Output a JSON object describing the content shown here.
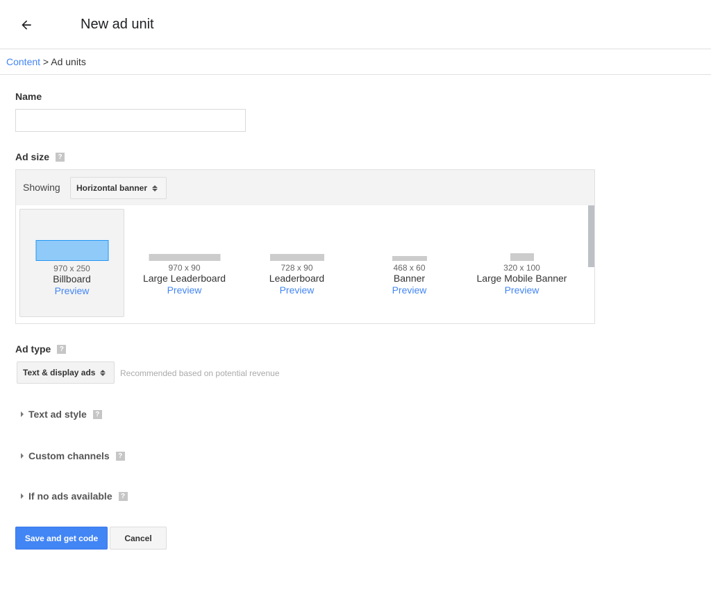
{
  "header": {
    "title": "New ad unit",
    "back_icon": "arrow-left-icon"
  },
  "breadcrumb": {
    "link": "Content",
    "separator": " > ",
    "current": "Ad units"
  },
  "form": {
    "name_label": "Name",
    "name_value": "",
    "ad_size_label": "Ad size",
    "help_glyph": "?",
    "showing_label": "Showing",
    "showing_value": "Horizontal banner",
    "sizes": [
      {
        "dim": "970 x 250",
        "name": "Billboard",
        "preview": "Preview",
        "selected": true
      },
      {
        "dim": "970 x 90",
        "name": "Large Leaderboard",
        "preview": "Preview",
        "selected": false
      },
      {
        "dim": "728 x 90",
        "name": "Leaderboard",
        "preview": "Preview",
        "selected": false
      },
      {
        "dim": "468 x 60",
        "name": "Banner",
        "preview": "Preview",
        "selected": false
      },
      {
        "dim": "320 x 100",
        "name": "Large Mobile Banner",
        "preview": "Preview",
        "selected": false
      }
    ],
    "ad_type_label": "Ad type",
    "ad_type_value": "Text & display ads",
    "ad_type_note": "Recommended based on potential revenue",
    "expanders": [
      {
        "label": "Text ad style"
      },
      {
        "label": "Custom channels"
      },
      {
        "label": "If no ads available"
      }
    ]
  },
  "actions": {
    "save_label": "Save and get code",
    "cancel_label": "Cancel"
  },
  "colors": {
    "accent": "#4285f4",
    "selected_thumb": "#90caf9",
    "selected_thumb_border": "#2196f3"
  }
}
